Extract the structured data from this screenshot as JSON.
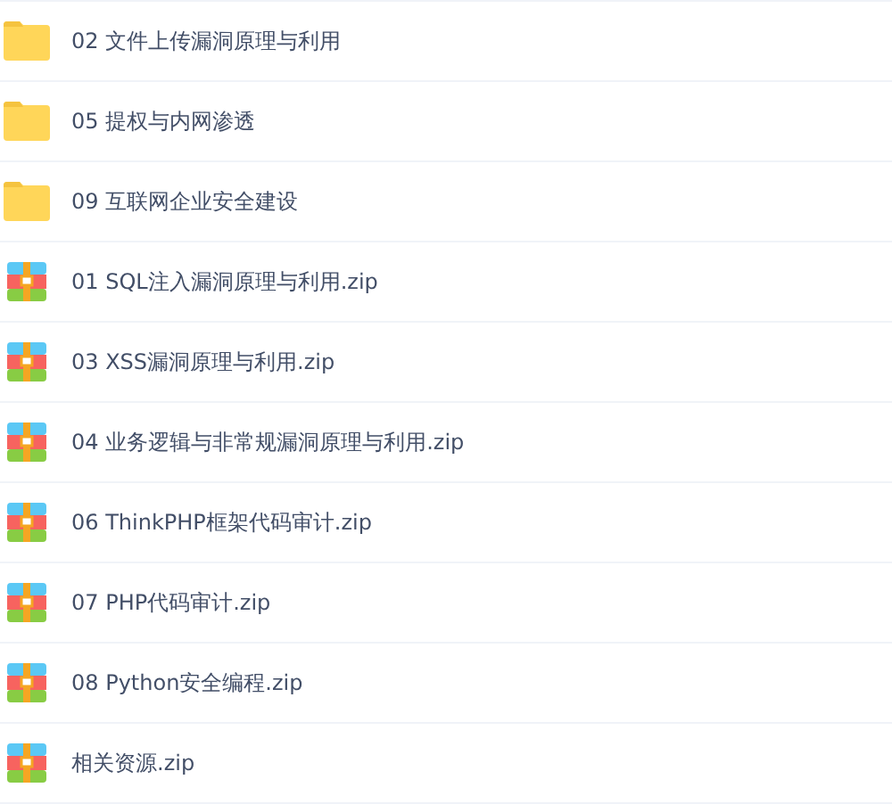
{
  "files": [
    {
      "kind": "folder",
      "name": "02 文件上传漏洞原理与利用"
    },
    {
      "kind": "folder",
      "name": "05 提权与内网渗透"
    },
    {
      "kind": "folder",
      "name": "09 互联网企业安全建设"
    },
    {
      "kind": "zip",
      "name": "01 SQL注入漏洞原理与利用.zip"
    },
    {
      "kind": "zip",
      "name": "03 XSS漏洞原理与利用.zip"
    },
    {
      "kind": "zip",
      "name": "04 业务逻辑与非常规漏洞原理与利用.zip"
    },
    {
      "kind": "zip",
      "name": "06 ThinkPHP框架代码审计.zip"
    },
    {
      "kind": "zip",
      "name": "07 PHP代码审计.zip"
    },
    {
      "kind": "zip",
      "name": "08 Python安全编程.zip"
    },
    {
      "kind": "zip",
      "name": "相关资源.zip"
    }
  ]
}
